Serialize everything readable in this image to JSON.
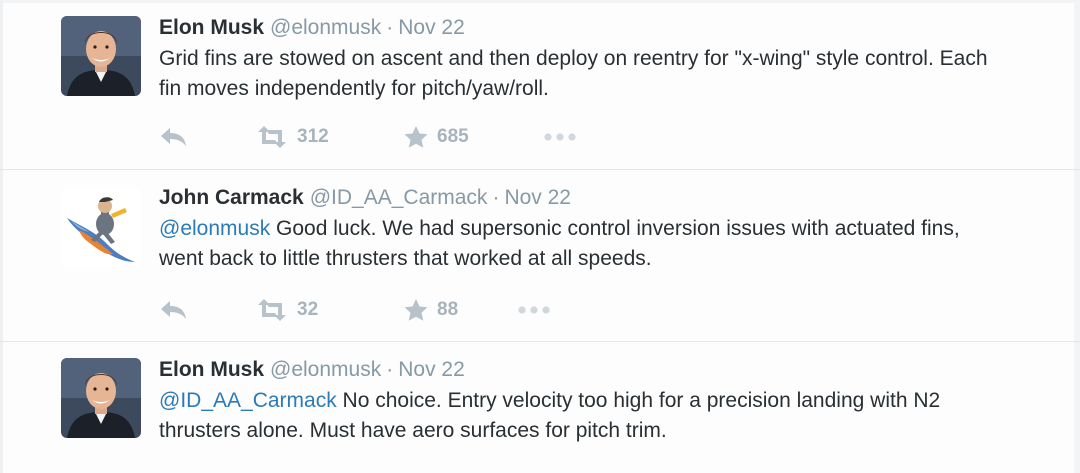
{
  "tweets": [
    {
      "avatar": "elon-musk-avatar",
      "fullname": "Elon Musk",
      "username": "@elonmusk",
      "separator": "·",
      "date": "Nov 22",
      "text": "Grid fins are stowed on ascent and then deploy on reentry for \"x-wing\" style control. Each fin moves independently for pitch/yaw/roll.",
      "retweets": "312",
      "favorites": "685"
    },
    {
      "avatar": "john-carmack-avatar",
      "fullname": "John Carmack",
      "username": "@ID_AA_Carmack",
      "separator": "·",
      "date": "Nov 22",
      "mention": "@elonmusk",
      "text": " Good luck. We had supersonic control inversion issues with actuated fins, went back to little thrusters that worked at all speeds.",
      "retweets": "32",
      "favorites": "88"
    },
    {
      "avatar": "elon-musk-avatar",
      "fullname": "Elon Musk",
      "username": "@elonmusk",
      "separator": "·",
      "date": "Nov 22",
      "mention": "@ID_AA_Carmack",
      "text": " No choice. Entry velocity too high for a precision landing with N2 thrusters alone. Must have aero surfaces for pitch trim."
    }
  ],
  "icons": {
    "reply": "reply-icon",
    "retweet": "retweet-icon",
    "favorite": "star-icon",
    "more": "more-dots-icon"
  },
  "colors": {
    "name": "#292f33",
    "meta": "#8899a6",
    "mention": "#2b7bb9",
    "action": "#a7b3bd",
    "divider": "#e1e8ed"
  }
}
